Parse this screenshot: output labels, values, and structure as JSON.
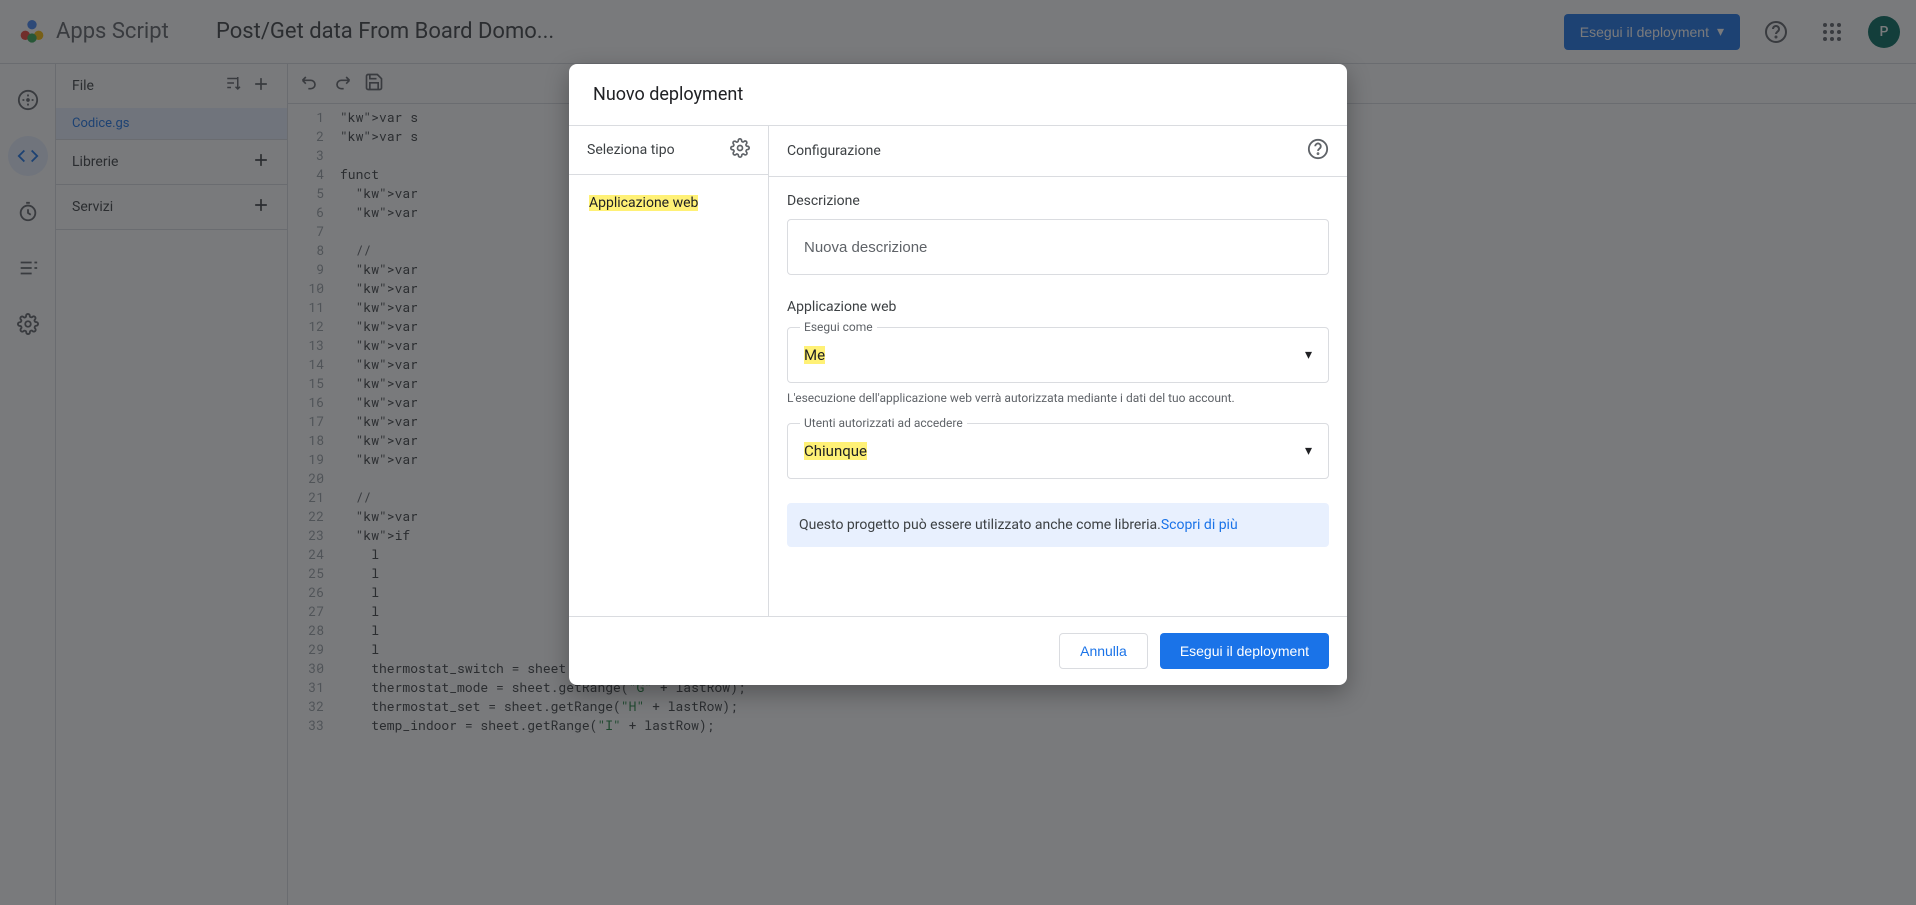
{
  "header": {
    "app_name": "Apps Script",
    "project_title": "Post/Get data From Board Domo...",
    "deploy_label": "Esegui il deployment",
    "avatar_letter": "P"
  },
  "sidebar": {
    "files_label": "File",
    "file_item": "Codice.gs",
    "libraries_label": "Librerie",
    "services_label": "Servizi"
  },
  "code": {
    "lines": [
      {
        "n": 1,
        "t": "var s"
      },
      {
        "n": 2,
        "t": "var s"
      },
      {
        "n": 3,
        "t": ""
      },
      {
        "n": 4,
        "t": "funct"
      },
      {
        "n": 5,
        "t": "  var"
      },
      {
        "n": 6,
        "t": "  var"
      },
      {
        "n": 7,
        "t": ""
      },
      {
        "n": 8,
        "t": "  // "
      },
      {
        "n": 9,
        "t": "  var"
      },
      {
        "n": 10,
        "t": "  var"
      },
      {
        "n": 11,
        "t": "  var"
      },
      {
        "n": 12,
        "t": "  var"
      },
      {
        "n": 13,
        "t": "  var"
      },
      {
        "n": 14,
        "t": "  var"
      },
      {
        "n": 15,
        "t": "  var"
      },
      {
        "n": 16,
        "t": "  var"
      },
      {
        "n": 17,
        "t": "  var"
      },
      {
        "n": 18,
        "t": "  var"
      },
      {
        "n": 19,
        "t": "  var"
      },
      {
        "n": 20,
        "t": ""
      },
      {
        "n": 21,
        "t": "  // "
      },
      {
        "n": 22,
        "t": "  var"
      },
      {
        "n": 23,
        "t": "  if "
      },
      {
        "n": 24,
        "t": "    l"
      },
      {
        "n": 25,
        "t": "    l"
      },
      {
        "n": 26,
        "t": "    l"
      },
      {
        "n": 27,
        "t": "    l"
      },
      {
        "n": 28,
        "t": "    l"
      },
      {
        "n": 29,
        "t": "    l"
      },
      {
        "n": 30,
        "t": "    thermostat_switch = sheet.getRange(\"F\" + lastRow);"
      },
      {
        "n": 31,
        "t": "    thermostat_mode = sheet.getRange(\"G\" + lastRow);"
      },
      {
        "n": 32,
        "t": "    thermostat_set = sheet.getRange(\"H\" + lastRow);"
      },
      {
        "n": 33,
        "t": "    temp_indoor = sheet.getRange(\"I\" + lastRow);"
      }
    ]
  },
  "dialog": {
    "title": "Nuovo deployment",
    "select_type_label": "Seleziona tipo",
    "type_item": "Applicazione web",
    "config_label": "Configurazione",
    "description_label": "Descrizione",
    "description_placeholder": "Nuova descrizione",
    "webapp_section": "Applicazione web",
    "execute_as_label": "Esegui come",
    "execute_as_value": "Me",
    "execute_as_helper": "L'esecuzione dell'applicazione web verrà autorizzata mediante i dati del tuo account.",
    "access_label": "Utenti autorizzati ad accedere",
    "access_value": "Chiunque",
    "info_text": "Questo progetto può essere utilizzato anche come libreria.",
    "info_link": "Scopri di più",
    "cancel_label": "Annulla",
    "deploy_label": "Esegui il deployment"
  }
}
